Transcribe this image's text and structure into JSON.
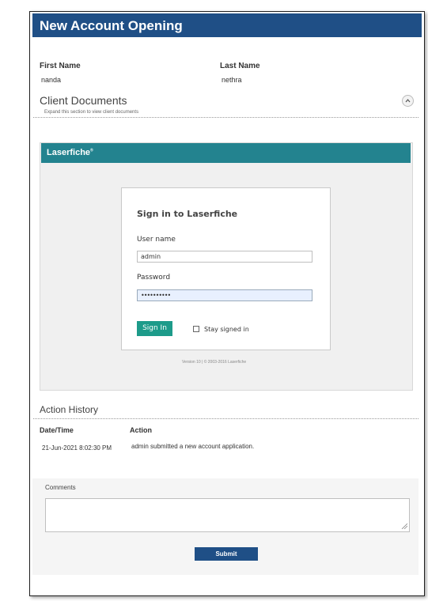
{
  "header": {
    "title": "New Account Opening"
  },
  "fields": {
    "first_name_label": "First Name",
    "first_name_value": "nanda",
    "last_name_label": "Last Name",
    "last_name_value": "nethra"
  },
  "client_documents": {
    "title": "Client Documents",
    "subtitle": "Expand this section to view client documents",
    "collapse_icon": "chevron-up-icon"
  },
  "laserfiche": {
    "logo": "Laserfiche",
    "logo_mark": "®",
    "sign_in_title": "Sign in to Laserfiche",
    "username_label": "User name",
    "username_value": "admin",
    "password_label": "Password",
    "password_value": "••••••••••",
    "sign_in_button": "Sign In",
    "stay_signed_in_label": "Stay signed in",
    "version_text": "Version 10 | © 2003-2016 Laserfiche",
    "colors": {
      "bar": "#23838f",
      "button": "#1d9b8a"
    }
  },
  "action_history": {
    "title": "Action History",
    "columns": [
      "Date/Time",
      "Action"
    ],
    "rows": [
      {
        "datetime": "21-Jun-2021 8:02:30 PM",
        "action": "admin submitted a new account application."
      }
    ]
  },
  "comments": {
    "label": "Comments",
    "value": ""
  },
  "submit": {
    "label": "Submit"
  },
  "colors": {
    "brand": "#1f4f86"
  }
}
